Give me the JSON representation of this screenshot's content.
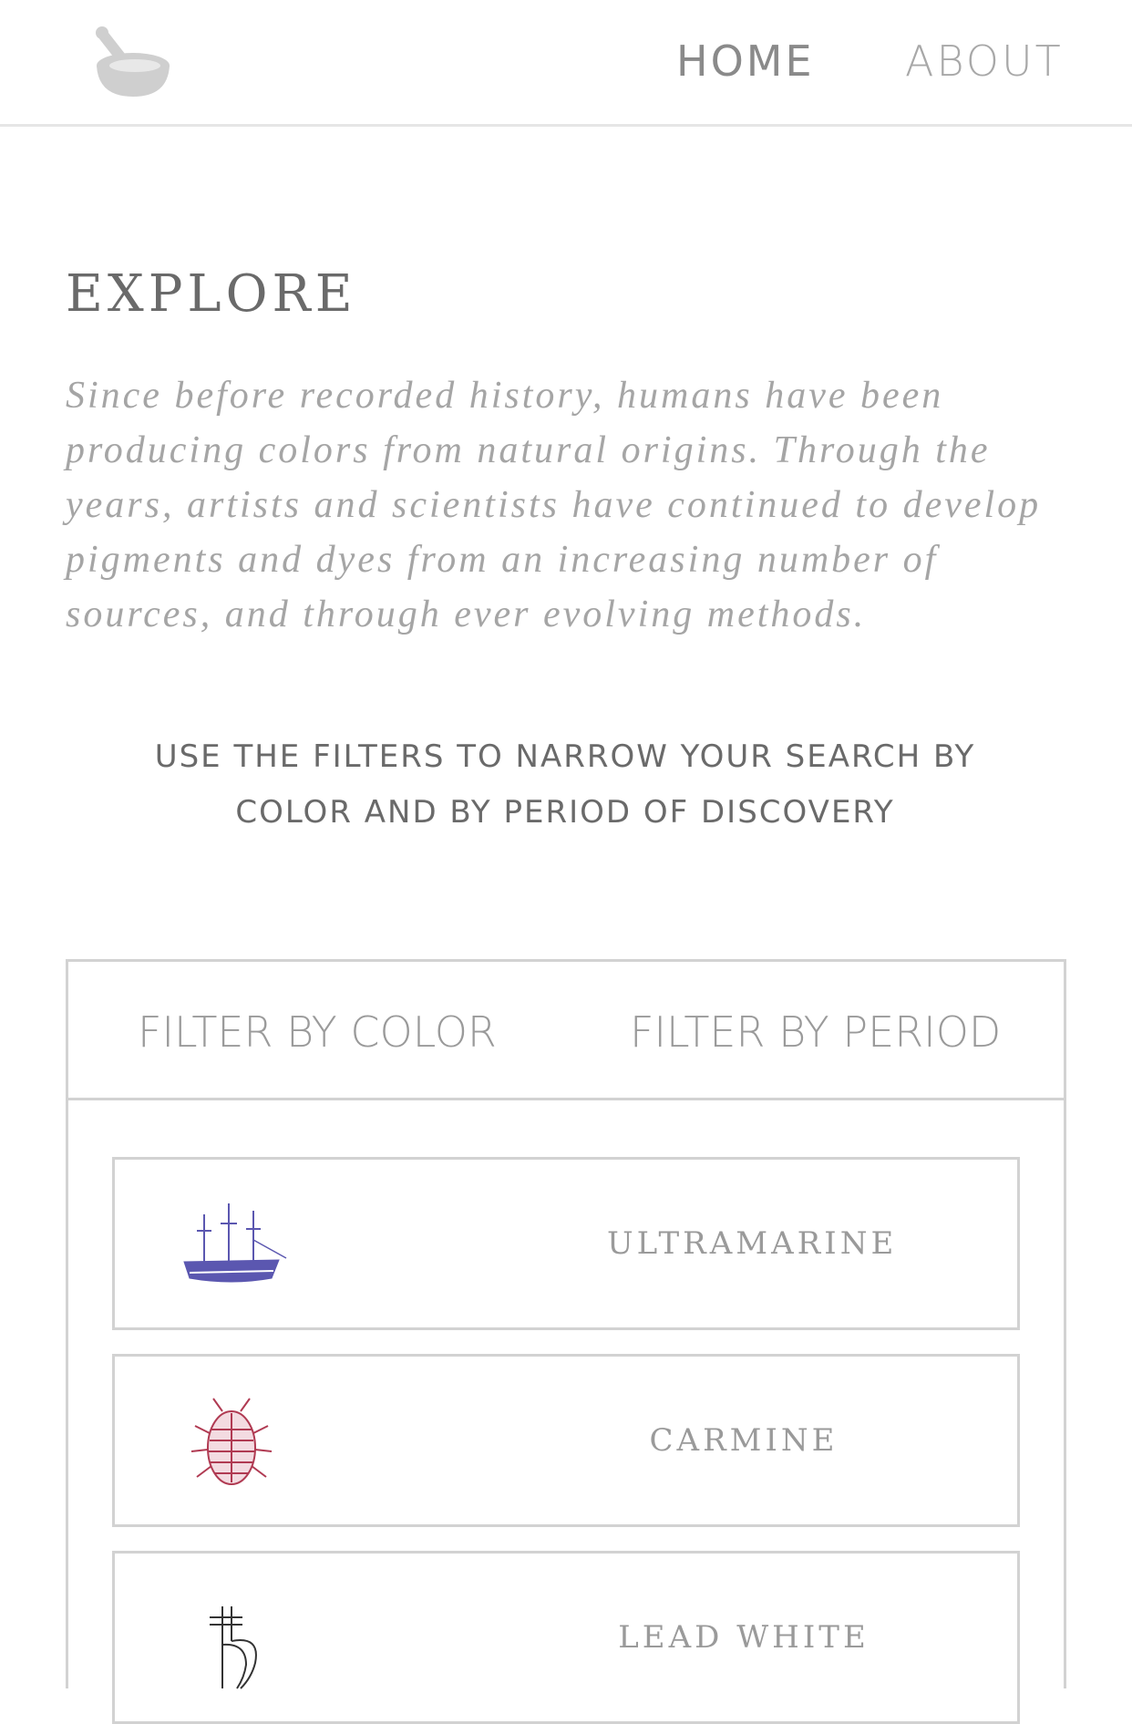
{
  "header": {
    "logo_icon": "mortar-and-pestle-icon",
    "nav": {
      "home": "HOME",
      "about": "ABOUT"
    }
  },
  "explore": {
    "title": "EXPLORE",
    "intro_lines": [
      "Since before recorded history, humans have been",
      "producing colors from natural origins. Through the",
      "years, artists and scientists have continued to develop",
      "pigments and dyes from an increasing number of",
      "sources, and through ever evolving methods."
    ],
    "instructions_lines": [
      "USE THE FILTERS TO NARROW YOUR SEARCH BY",
      "COLOR AND BY PERIOD OF DISCOVERY"
    ]
  },
  "filters": {
    "tabs": [
      {
        "label": "FILTER BY COLOR"
      },
      {
        "label": "FILTER BY PERIOD"
      }
    ],
    "items": [
      {
        "label": "ULTRAMARINE",
        "icon": "sailing-ship-icon",
        "color": "#5b57b0"
      },
      {
        "label": "CARMINE",
        "icon": "cochineal-insect-icon",
        "color": "#b03a52"
      },
      {
        "label": "LEAD WHITE",
        "icon": "saturn-symbol-icon",
        "color": "#333333"
      }
    ]
  }
}
